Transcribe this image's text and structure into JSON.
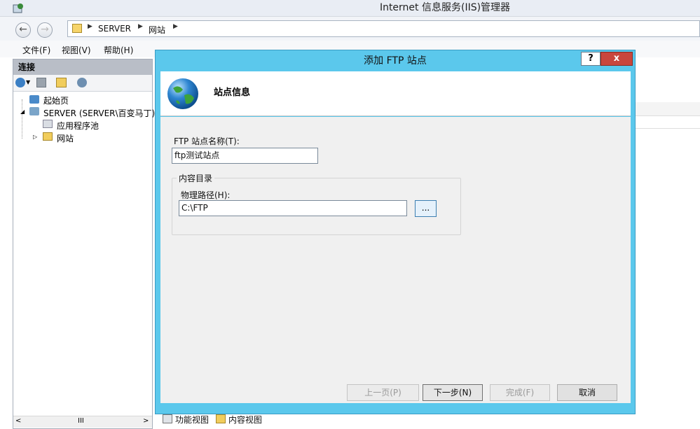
{
  "window": {
    "title": "Internet 信息服务(IIS)管理器"
  },
  "address": {
    "segments": [
      "SERVER",
      "网站"
    ]
  },
  "menu": {
    "file": "文件(F)",
    "view": "视图(V)",
    "help": "帮助(H)"
  },
  "connections": {
    "header": "连接",
    "tree": [
      {
        "label": "起始页"
      },
      {
        "label": "SERVER (SERVER\\百变马丁)"
      },
      {
        "label": "应用程序池"
      },
      {
        "label": "网站"
      }
    ],
    "scroll_mid": "III"
  },
  "bottom_tabs": {
    "features": "功能视图",
    "content": "内容视图"
  },
  "dialog": {
    "title": "添加 FTP 站点",
    "help": "?",
    "close": "x",
    "page_title": "站点信息",
    "site_name_label": "FTP 站点名称(T):",
    "site_name_value": "ftp测试站点",
    "content_dir_label": "内容目录",
    "physical_path_label": "物理路径(H):",
    "physical_path_value": "C:\\FTP",
    "browse": "...",
    "buttons": {
      "prev": "上一页(P)",
      "next": "下一步(N)",
      "finish": "完成(F)",
      "cancel": "取消"
    }
  }
}
